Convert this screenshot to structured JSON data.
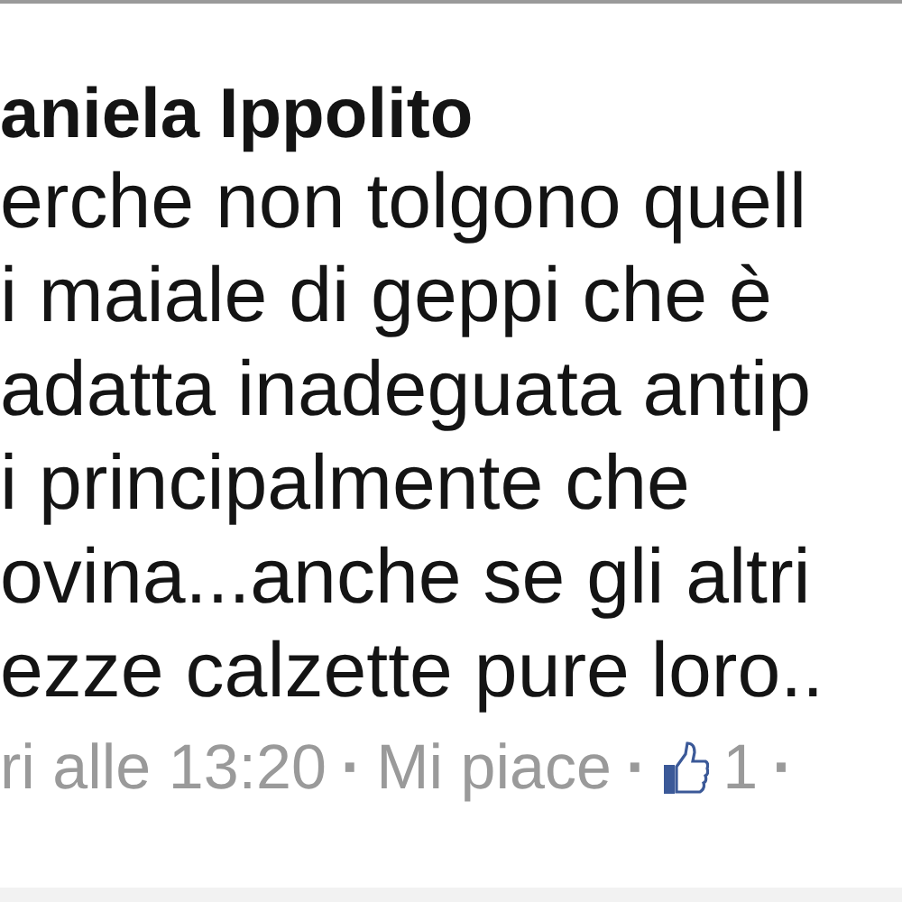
{
  "author": "aniela Ippolito",
  "lines": [
    "erche non tolgono quell",
    "i maiale di geppi che è",
    "adatta inadeguata antip",
    "i principalmente che",
    "ovina...anche se gli altri",
    "ezze calzette pure loro.."
  ],
  "footer": [
    {
      "kind": "time",
      "text": "ri alle 13:20"
    },
    {
      "kind": "separator",
      "text": "·"
    },
    {
      "kind": "link",
      "text": "Mi piace"
    },
    {
      "kind": "separator",
      "text": "·"
    },
    {
      "kind": "likes",
      "text": "1"
    },
    {
      "kind": "separator",
      "text": "·"
    }
  ]
}
